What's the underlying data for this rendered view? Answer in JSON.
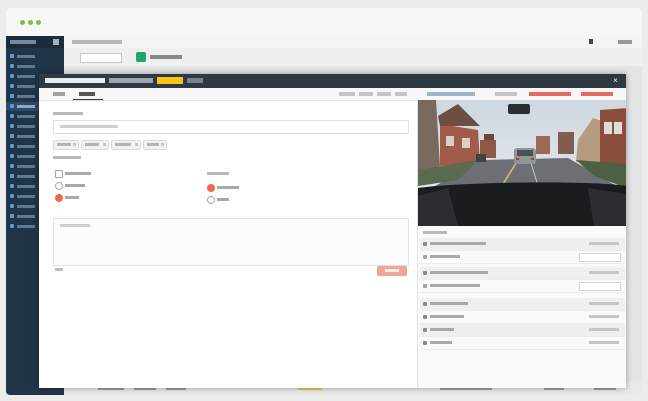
{
  "browser": {
    "address_text": ""
  },
  "app": {
    "brand": ""
  },
  "sidebar": {
    "items": [
      {
        "label": ""
      },
      {
        "label": ""
      },
      {
        "label": ""
      },
      {
        "label": ""
      },
      {
        "label": ""
      },
      {
        "label": ""
      },
      {
        "label": ""
      },
      {
        "label": ""
      },
      {
        "label": ""
      },
      {
        "label": ""
      },
      {
        "label": ""
      },
      {
        "label": ""
      },
      {
        "label": ""
      },
      {
        "label": ""
      },
      {
        "label": ""
      },
      {
        "label": ""
      },
      {
        "label": ""
      },
      {
        "label": ""
      }
    ],
    "active_index": 5
  },
  "background_page": {
    "breadcrumb": "",
    "user": "",
    "toolbar_labels": [
      "",
      ""
    ],
    "row_cells": [
      "",
      "",
      "",
      "",
      "",
      "",
      ""
    ]
  },
  "modal": {
    "title": "",
    "subtitle": "",
    "badge": "",
    "badge_color": "#f5c518",
    "close_glyph": "×",
    "tabs": [
      {
        "label": ""
      },
      {
        "label": ""
      }
    ],
    "header_actions": [
      "",
      "",
      "",
      "",
      "",
      "",
      "",
      ""
    ],
    "form": {
      "field_label": "",
      "input_placeholder": "",
      "tags": [
        "",
        "",
        "",
        ""
      ],
      "section_label": "",
      "group_a": [
        {
          "label": ""
        },
        {
          "label": ""
        },
        {
          "label": ""
        }
      ],
      "group_b_label": "",
      "group_b": [
        {
          "label": ""
        },
        {
          "label": ""
        }
      ],
      "comment_placeholder": "",
      "char_count": "",
      "save_label": ""
    },
    "video": {
      "alt": ""
    },
    "events_label": "",
    "events": [
      {
        "title": "",
        "date": ""
      },
      {
        "title": "",
        "action": ""
      },
      {
        "title": "",
        "date": ""
      },
      {
        "title": "",
        "action": ""
      },
      {
        "title": "",
        "date": ""
      },
      {
        "title": "",
        "date": ""
      },
      {
        "title": "",
        "date": ""
      },
      {
        "title": "",
        "date": ""
      }
    ]
  },
  "colors": {
    "accent_red": "#ec6a4c",
    "header_dark": "#2e3944",
    "sidebar_navy": "#213548",
    "window_dot_green": "#7cc242"
  }
}
